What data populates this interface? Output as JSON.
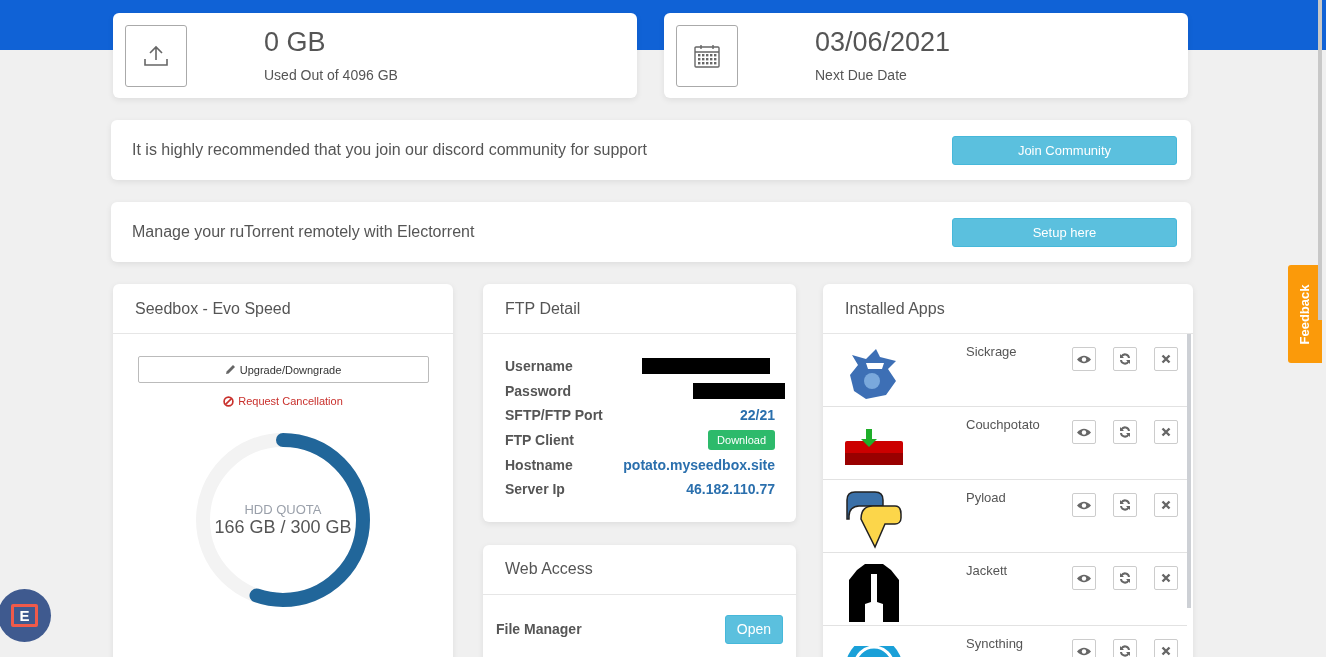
{
  "stats": [
    {
      "value": "0 GB",
      "label": "Used Out of 4096 GB"
    },
    {
      "value": "03/06/2021",
      "label": "Next Due Date"
    }
  ],
  "banners": [
    {
      "text": "It is highly recommended that you join our discord community for support",
      "button": "Join Community"
    },
    {
      "text": "Manage your ruTorrent remotely with Electorrent",
      "button": "Setup here"
    }
  ],
  "plan": {
    "title": "Seedbox - Evo Speed",
    "upgrade_button": "Upgrade/Downgrade",
    "cancel_link": "Request Cancellation",
    "quota": {
      "label": "HDD QUOTA",
      "reading": "166 GB / 300 GB",
      "level": 0.553
    }
  },
  "ftp": {
    "title": "FTP Detail",
    "rows": [
      {
        "label": "Username",
        "kind": "redacted"
      },
      {
        "label": "Password",
        "kind": "redacted"
      },
      {
        "label": "SFTP/FTP Port",
        "kind": "text",
        "value": "22/21"
      },
      {
        "label": "FTP Client",
        "kind": "button",
        "value": "Download"
      },
      {
        "label": "Hostname",
        "kind": "text",
        "value": "potato.myseedbox.site"
      },
      {
        "label": "Server Ip",
        "kind": "text",
        "value": "46.182.110.77"
      }
    ]
  },
  "web_access": {
    "title": "Web Access",
    "rows": [
      {
        "label": "File Manager",
        "button": "Open"
      }
    ]
  },
  "apps": {
    "title": "Installed Apps",
    "items": [
      {
        "name": "Sickrage"
      },
      {
        "name": "Couchpotato"
      },
      {
        "name": "Pyload"
      },
      {
        "name": "Jackett"
      },
      {
        "name": "Syncthing"
      }
    ]
  },
  "feedback_tab": "Feedback",
  "chat_widget": {
    "letter": "E"
  }
}
